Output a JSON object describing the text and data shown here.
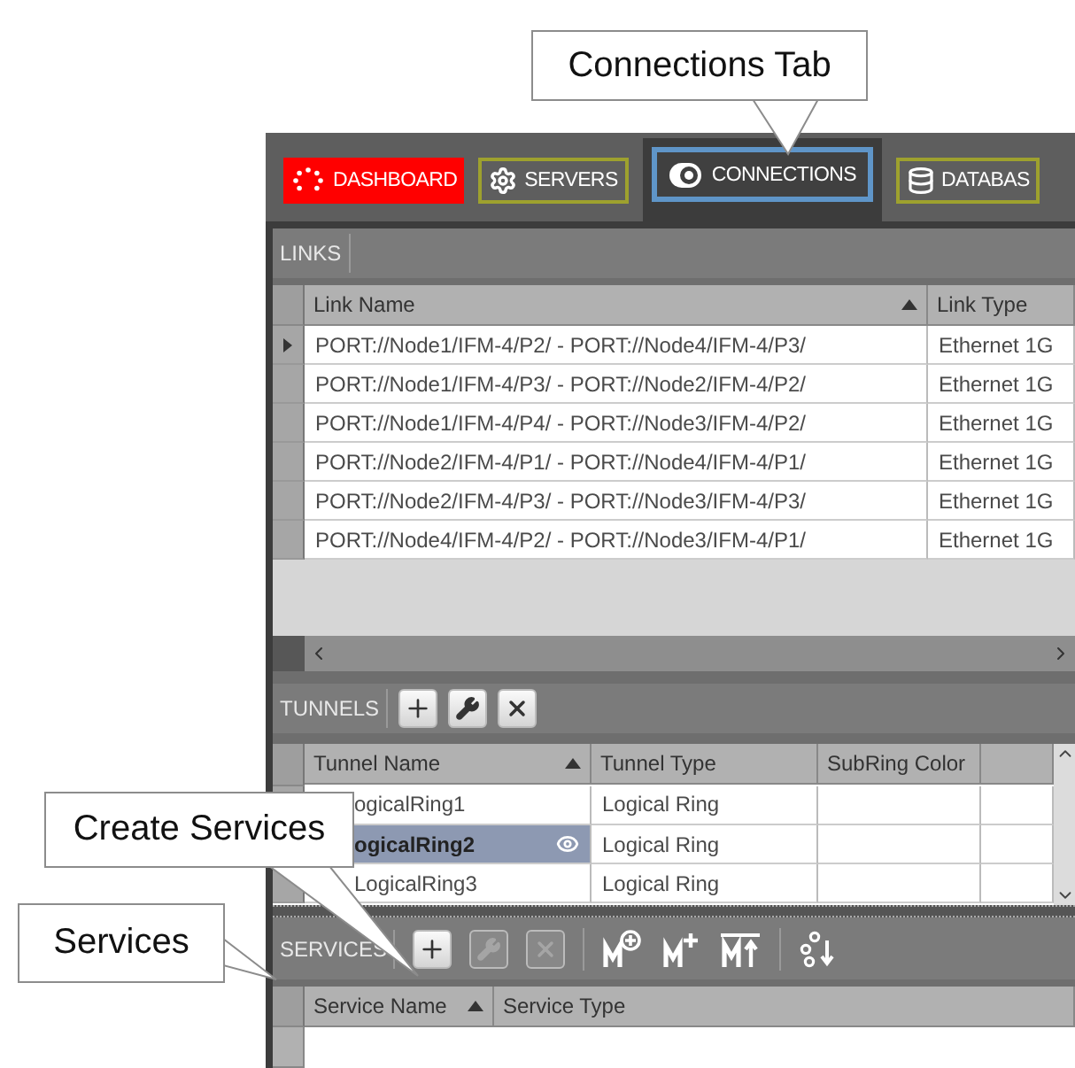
{
  "tabs": [
    {
      "label": "DASHBOARD",
      "kind": "dashboard",
      "selected": false
    },
    {
      "label": "SERVERS",
      "kind": "servers",
      "selected": false
    },
    {
      "label": "CONNECTIONS",
      "kind": "connections",
      "selected": true
    },
    {
      "label": "DATABAS",
      "kind": "database",
      "selected": false
    }
  ],
  "links": {
    "title": "LINKS",
    "columns": [
      {
        "label": "Link Name",
        "sorted": true
      },
      {
        "label": "Link Type",
        "sorted": false
      }
    ],
    "rows": [
      {
        "current": true,
        "cells": [
          "PORT://Node1/IFM-4/P2/ - PORT://Node4/IFM-4/P3/",
          "Ethernet 1G"
        ]
      },
      {
        "current": false,
        "cells": [
          "PORT://Node1/IFM-4/P3/ - PORT://Node2/IFM-4/P2/",
          "Ethernet 1G"
        ]
      },
      {
        "current": false,
        "cells": [
          "PORT://Node1/IFM-4/P4/ - PORT://Node3/IFM-4/P2/",
          "Ethernet 1G"
        ]
      },
      {
        "current": false,
        "cells": [
          "PORT://Node2/IFM-4/P1/ - PORT://Node4/IFM-4/P1/",
          "Ethernet 1G"
        ]
      },
      {
        "current": false,
        "cells": [
          "PORT://Node2/IFM-4/P3/ - PORT://Node3/IFM-4/P3/",
          "Ethernet 1G"
        ]
      },
      {
        "current": false,
        "cells": [
          "PORT://Node4/IFM-4/P2/ - PORT://Node3/IFM-4/P1/",
          "Ethernet 1G"
        ]
      }
    ]
  },
  "tunnels": {
    "title": "TUNNELS",
    "tools": [
      {
        "kind": "add",
        "disabled": false
      },
      {
        "kind": "edit",
        "disabled": false
      },
      {
        "kind": "delete",
        "disabled": false
      }
    ],
    "columns": [
      {
        "label": "Tunnel Name",
        "sorted": true
      },
      {
        "label": "Tunnel Type",
        "sorted": false
      },
      {
        "label": "SubRing Color",
        "sorted": false
      }
    ],
    "rows": [
      {
        "selected": false,
        "cells": [
          "ogicalRing1",
          "Logical Ring"
        ]
      },
      {
        "selected": true,
        "cells": [
          "ogicalRing2",
          "Logical Ring"
        ]
      },
      {
        "selected": false,
        "cells": [
          "LogicalRing3",
          "Logical Ring"
        ]
      }
    ]
  },
  "services": {
    "title": "SERVICES",
    "tools": [
      {
        "kind": "add",
        "disabled": false
      },
      {
        "kind": "edit",
        "disabled": true
      },
      {
        "kind": "delete",
        "disabled": true
      },
      {
        "kind": "separator"
      },
      {
        "kind": "m-circle-plus",
        "disabled": false
      },
      {
        "kind": "m-plus",
        "disabled": false
      },
      {
        "kind": "m-bar-up",
        "disabled": false
      },
      {
        "kind": "separator"
      },
      {
        "kind": "nodes-down",
        "disabled": false
      }
    ],
    "columns": [
      {
        "label": "Service Name",
        "sorted": true
      },
      {
        "label": "Service Type",
        "sorted": false
      }
    ]
  },
  "callouts": [
    {
      "text": "Connections Tab"
    },
    {
      "text": "Create Services"
    },
    {
      "text": "Services"
    }
  ]
}
